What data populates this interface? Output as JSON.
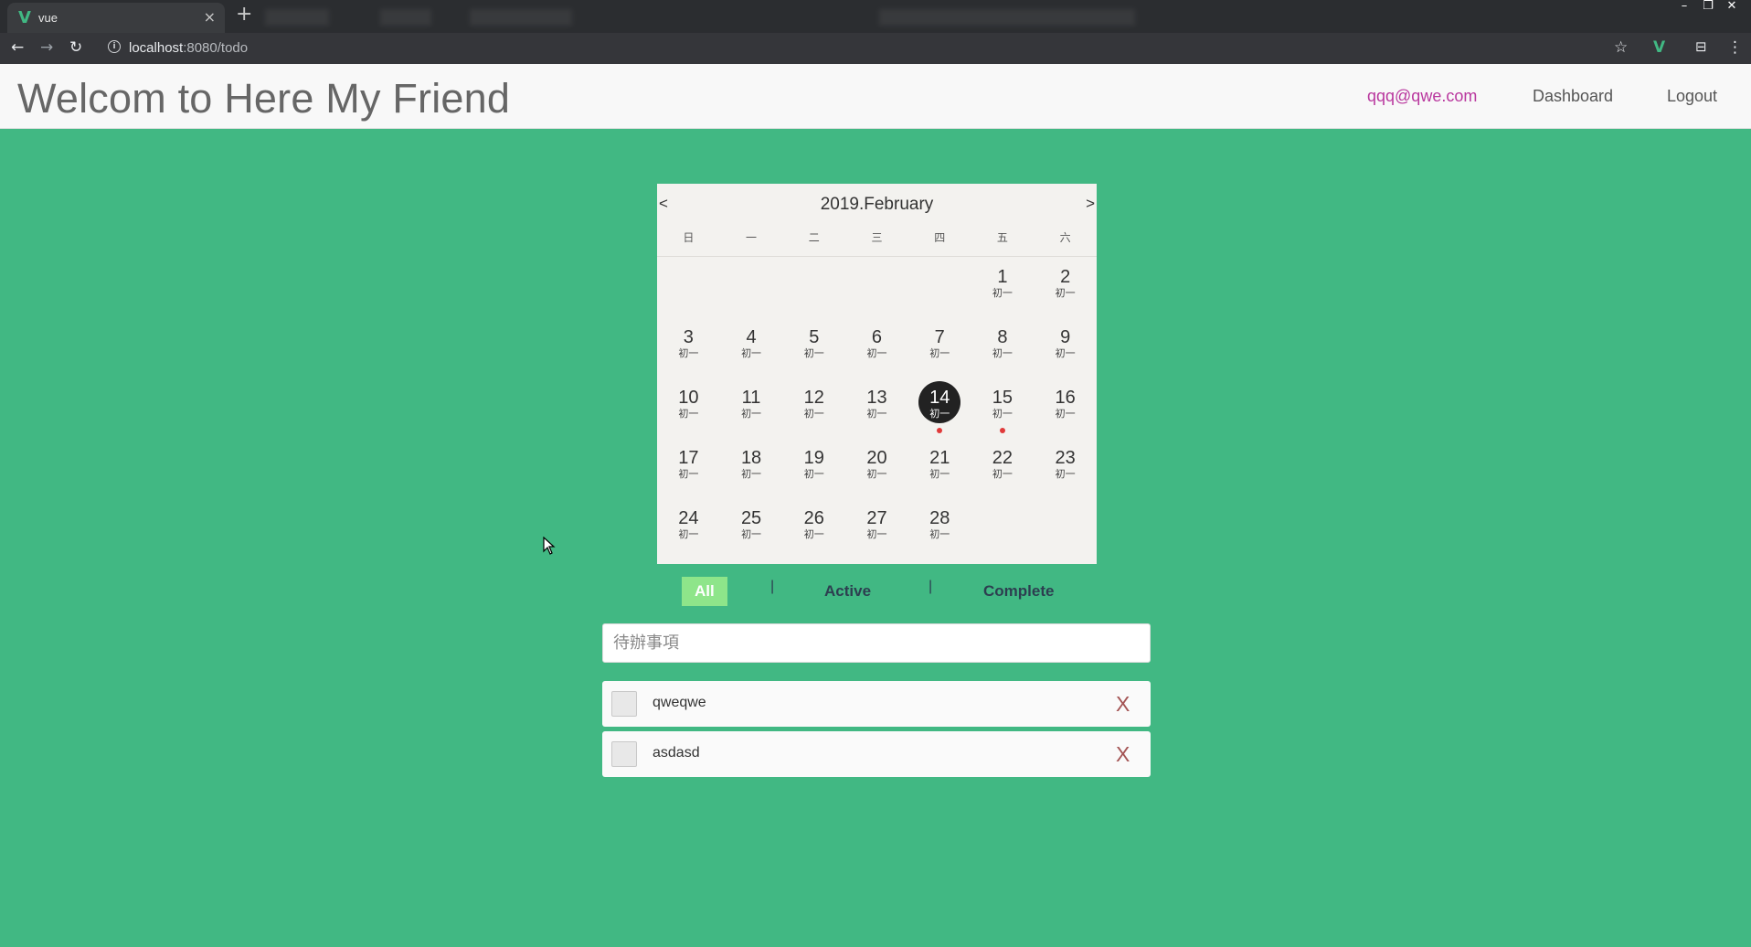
{
  "browser": {
    "tab_title": "vue",
    "tab_logo": "V",
    "tab_close": "×",
    "new_tab": "+",
    "url_host": "localhost",
    "url_rest": ":8080/todo",
    "icons": [
      "back-arrow-icon",
      "forward-arrow-icon",
      "reload-icon",
      "info-icon",
      "star-icon",
      "vue-devtools-icon",
      "cast-icon",
      "menu-icon"
    ]
  },
  "header": {
    "title": "Welcom to Here My Friend",
    "email": "qqq@qwe.com",
    "dashboard": "Dashboard",
    "logout": "Logout",
    "email_color": "#b9379e"
  },
  "calendar": {
    "prev": "<",
    "next": ">",
    "title": "2019.February",
    "weekdays": [
      "日",
      "一",
      "二",
      "三",
      "四",
      "五",
      "六"
    ],
    "lunar_label": "初一",
    "days": [
      "",
      "",
      "",
      "",
      "",
      "1",
      "2",
      "3",
      "4",
      "5",
      "6",
      "7",
      "8",
      "9",
      "10",
      "11",
      "12",
      "13",
      "14",
      "15",
      "16",
      "17",
      "18",
      "19",
      "20",
      "21",
      "22",
      "23",
      "24",
      "25",
      "26",
      "27",
      "28",
      "",
      ""
    ],
    "selected_day": "14",
    "marked_days": [
      "14",
      "15"
    ]
  },
  "filters": {
    "all": "All",
    "sep": "|",
    "active": "Active",
    "complete": "Complete",
    "selected": "All",
    "selected_color": "#8ee58a"
  },
  "todo": {
    "placeholder": "待辦事項",
    "items": [
      {
        "text": "qweqwe",
        "done": false
      },
      {
        "text": "asdasd",
        "done": false
      }
    ],
    "delete_label": "X"
  },
  "colors": {
    "background": "#41b883",
    "header_bg": "#f8f8f8"
  }
}
